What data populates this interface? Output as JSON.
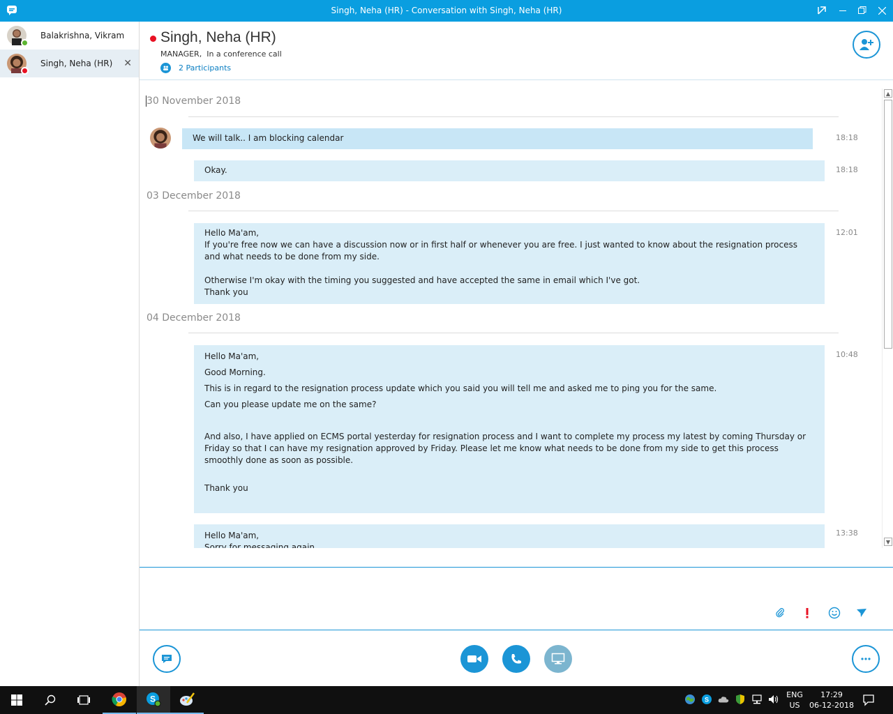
{
  "window": {
    "title": "Singh, Neha (HR) - Conversation with Singh, Neha (HR)"
  },
  "sidebar": {
    "contacts": [
      {
        "name": "Balakrishna, Vikram",
        "status": "available",
        "status_color": "#5cb531"
      },
      {
        "name": "Singh, Neha (HR)",
        "status": "busy",
        "status_color": "#e81123",
        "active": true
      }
    ]
  },
  "conversation": {
    "name": "Singh, Neha (HR)",
    "role": "MANAGER",
    "status_text": "In a conference call",
    "participants_label": "2 Participants"
  },
  "messages": {
    "groups": [
      {
        "date": "30 November 2018",
        "items": [
          {
            "text": "We will talk.. I am blocking calendar",
            "time": "18:18",
            "incoming": true
          },
          {
            "text": "Okay.",
            "time": "18:18",
            "incoming": false
          }
        ]
      },
      {
        "date": "03 December 2018",
        "items": [
          {
            "time": "12:01",
            "lines": [
              "Hello Ma'am,",
              "If you're free now we can have a discussion now or in first half or whenever you are free. I just wanted to know about the resignation process and what needs to be done from my side.",
              "",
              "Otherwise I'm okay with the timing you suggested and have accepted the same in email which I've got.",
              "Thank you"
            ]
          }
        ]
      },
      {
        "date": "04 December 2018",
        "items": [
          {
            "time": "10:48",
            "lines": [
              "Hello Ma'am,",
              "Good Morning.",
              "This is in regard to the resignation process update which you said you will tell me and asked me to ping you for the same.",
              "Can you please update me on the same?",
              "And also, I have applied on ECMS portal yesterday for resignation process and I want to complete my process my latest by coming Thursday or Friday so that I can have my resignation approved by Friday. Please let me know what needs to be done from my side to get this process smoothly done as soon as possible.",
              "Thank you"
            ]
          },
          {
            "time": "13:38",
            "lines": [
              "Hello Ma'am,",
              "Sorry for messaging again"
            ]
          }
        ]
      }
    ]
  },
  "compose": {
    "icons": [
      "paperclip-icon",
      "importance-icon",
      "emoticon-icon",
      "send-icon"
    ],
    "importance_color": "#e81123"
  },
  "actions": {
    "icons": [
      "chat-icon",
      "video-icon",
      "phone-icon",
      "present-screen-icon",
      "more-icon"
    ]
  },
  "taskbar": {
    "lang_top": "ENG",
    "lang_bottom": "US",
    "time": "17:29",
    "date": "06-12-2018"
  },
  "colors": {
    "accent": "#0a9ee0",
    "bubble_out": "#daeef8",
    "bubble_in": "#c8e6f6"
  }
}
